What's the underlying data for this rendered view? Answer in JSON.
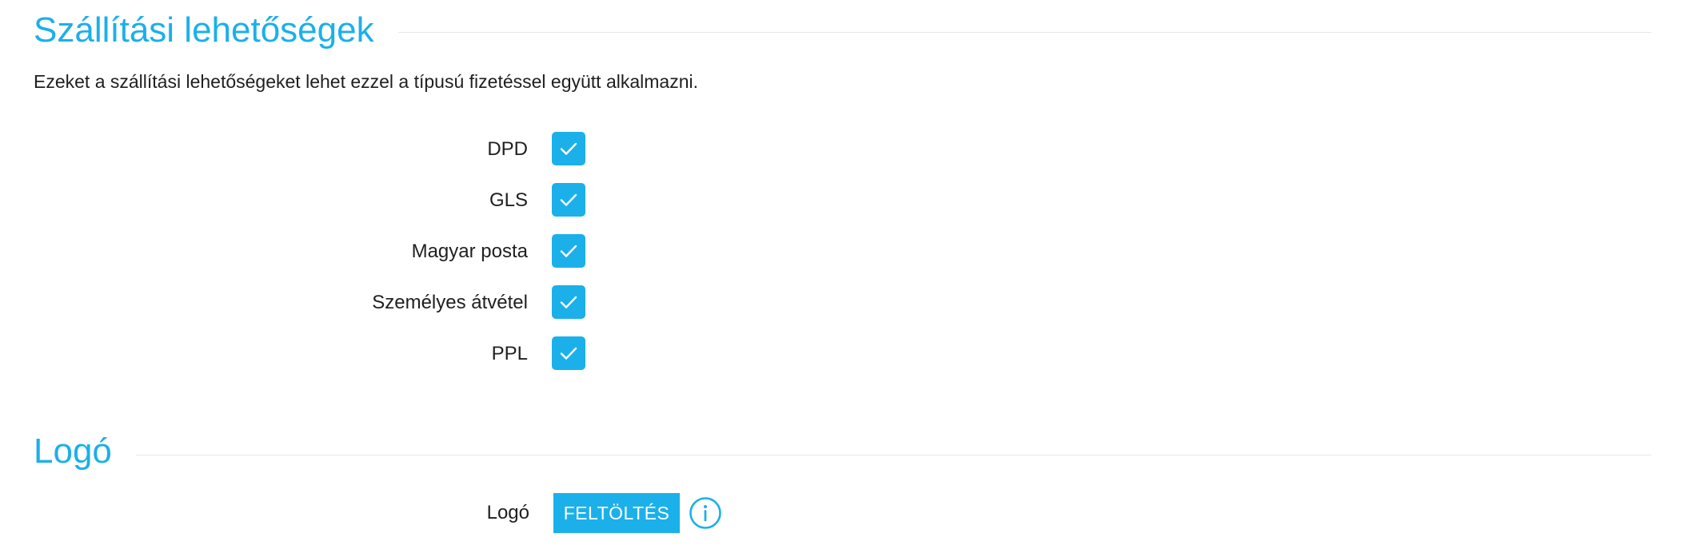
{
  "shipping_section": {
    "title": "Szállítási lehetőségek",
    "description": "Ezeket a szállítási lehetőségeket lehet ezzel a típusú fizetéssel együtt alkalmazni.",
    "options": [
      {
        "label": "DPD",
        "checked": true
      },
      {
        "label": "GLS",
        "checked": true
      },
      {
        "label": "Magyar posta",
        "checked": true
      },
      {
        "label": "Személyes átvétel",
        "checked": true
      },
      {
        "label": "PPL",
        "checked": true
      }
    ]
  },
  "logo_section": {
    "title": "Logó",
    "field_label": "Logó",
    "upload_label": "FELTÖLTÉS",
    "info_icon": "info-circle-icon"
  },
  "colors": {
    "accent": "#1bb0ea",
    "text": "#1f1f1f",
    "rule": "#e6e8eb"
  }
}
